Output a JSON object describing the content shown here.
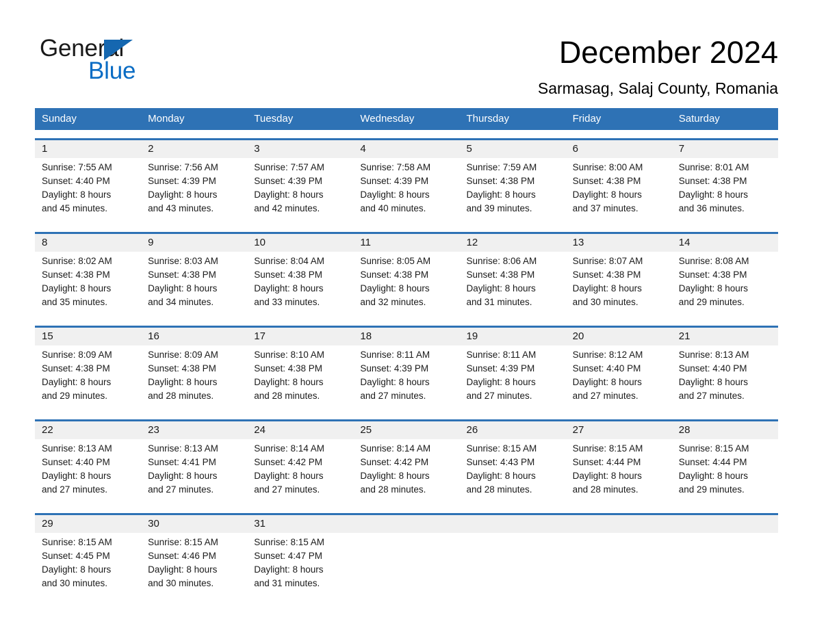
{
  "brand": {
    "name_part1": "General",
    "name_part2": "Blue",
    "accent_color": "#0a6cc4",
    "triangle_color": "#1567b0"
  },
  "header": {
    "month_title": "December 2024",
    "location": "Sarmasag, Salaj County, Romania"
  },
  "calendar": {
    "header_color": "#2e72b5",
    "daynum_strip_color": "#f0f0f0",
    "weekdays": [
      "Sunday",
      "Monday",
      "Tuesday",
      "Wednesday",
      "Thursday",
      "Friday",
      "Saturday"
    ],
    "weeks": [
      [
        {
          "day": "1",
          "sunrise": "Sunrise: 7:55 AM",
          "sunset": "Sunset: 4:40 PM",
          "daylight_line1": "Daylight: 8 hours",
          "daylight_line2": "and 45 minutes."
        },
        {
          "day": "2",
          "sunrise": "Sunrise: 7:56 AM",
          "sunset": "Sunset: 4:39 PM",
          "daylight_line1": "Daylight: 8 hours",
          "daylight_line2": "and 43 minutes."
        },
        {
          "day": "3",
          "sunrise": "Sunrise: 7:57 AM",
          "sunset": "Sunset: 4:39 PM",
          "daylight_line1": "Daylight: 8 hours",
          "daylight_line2": "and 42 minutes."
        },
        {
          "day": "4",
          "sunrise": "Sunrise: 7:58 AM",
          "sunset": "Sunset: 4:39 PM",
          "daylight_line1": "Daylight: 8 hours",
          "daylight_line2": "and 40 minutes."
        },
        {
          "day": "5",
          "sunrise": "Sunrise: 7:59 AM",
          "sunset": "Sunset: 4:38 PM",
          "daylight_line1": "Daylight: 8 hours",
          "daylight_line2": "and 39 minutes."
        },
        {
          "day": "6",
          "sunrise": "Sunrise: 8:00 AM",
          "sunset": "Sunset: 4:38 PM",
          "daylight_line1": "Daylight: 8 hours",
          "daylight_line2": "and 37 minutes."
        },
        {
          "day": "7",
          "sunrise": "Sunrise: 8:01 AM",
          "sunset": "Sunset: 4:38 PM",
          "daylight_line1": "Daylight: 8 hours",
          "daylight_line2": "and 36 minutes."
        }
      ],
      [
        {
          "day": "8",
          "sunrise": "Sunrise: 8:02 AM",
          "sunset": "Sunset: 4:38 PM",
          "daylight_line1": "Daylight: 8 hours",
          "daylight_line2": "and 35 minutes."
        },
        {
          "day": "9",
          "sunrise": "Sunrise: 8:03 AM",
          "sunset": "Sunset: 4:38 PM",
          "daylight_line1": "Daylight: 8 hours",
          "daylight_line2": "and 34 minutes."
        },
        {
          "day": "10",
          "sunrise": "Sunrise: 8:04 AM",
          "sunset": "Sunset: 4:38 PM",
          "daylight_line1": "Daylight: 8 hours",
          "daylight_line2": "and 33 minutes."
        },
        {
          "day": "11",
          "sunrise": "Sunrise: 8:05 AM",
          "sunset": "Sunset: 4:38 PM",
          "daylight_line1": "Daylight: 8 hours",
          "daylight_line2": "and 32 minutes."
        },
        {
          "day": "12",
          "sunrise": "Sunrise: 8:06 AM",
          "sunset": "Sunset: 4:38 PM",
          "daylight_line1": "Daylight: 8 hours",
          "daylight_line2": "and 31 minutes."
        },
        {
          "day": "13",
          "sunrise": "Sunrise: 8:07 AM",
          "sunset": "Sunset: 4:38 PM",
          "daylight_line1": "Daylight: 8 hours",
          "daylight_line2": "and 30 minutes."
        },
        {
          "day": "14",
          "sunrise": "Sunrise: 8:08 AM",
          "sunset": "Sunset: 4:38 PM",
          "daylight_line1": "Daylight: 8 hours",
          "daylight_line2": "and 29 minutes."
        }
      ],
      [
        {
          "day": "15",
          "sunrise": "Sunrise: 8:09 AM",
          "sunset": "Sunset: 4:38 PM",
          "daylight_line1": "Daylight: 8 hours",
          "daylight_line2": "and 29 minutes."
        },
        {
          "day": "16",
          "sunrise": "Sunrise: 8:09 AM",
          "sunset": "Sunset: 4:38 PM",
          "daylight_line1": "Daylight: 8 hours",
          "daylight_line2": "and 28 minutes."
        },
        {
          "day": "17",
          "sunrise": "Sunrise: 8:10 AM",
          "sunset": "Sunset: 4:38 PM",
          "daylight_line1": "Daylight: 8 hours",
          "daylight_line2": "and 28 minutes."
        },
        {
          "day": "18",
          "sunrise": "Sunrise: 8:11 AM",
          "sunset": "Sunset: 4:39 PM",
          "daylight_line1": "Daylight: 8 hours",
          "daylight_line2": "and 27 minutes."
        },
        {
          "day": "19",
          "sunrise": "Sunrise: 8:11 AM",
          "sunset": "Sunset: 4:39 PM",
          "daylight_line1": "Daylight: 8 hours",
          "daylight_line2": "and 27 minutes."
        },
        {
          "day": "20",
          "sunrise": "Sunrise: 8:12 AM",
          "sunset": "Sunset: 4:40 PM",
          "daylight_line1": "Daylight: 8 hours",
          "daylight_line2": "and 27 minutes."
        },
        {
          "day": "21",
          "sunrise": "Sunrise: 8:13 AM",
          "sunset": "Sunset: 4:40 PM",
          "daylight_line1": "Daylight: 8 hours",
          "daylight_line2": "and 27 minutes."
        }
      ],
      [
        {
          "day": "22",
          "sunrise": "Sunrise: 8:13 AM",
          "sunset": "Sunset: 4:40 PM",
          "daylight_line1": "Daylight: 8 hours",
          "daylight_line2": "and 27 minutes."
        },
        {
          "day": "23",
          "sunrise": "Sunrise: 8:13 AM",
          "sunset": "Sunset: 4:41 PM",
          "daylight_line1": "Daylight: 8 hours",
          "daylight_line2": "and 27 minutes."
        },
        {
          "day": "24",
          "sunrise": "Sunrise: 8:14 AM",
          "sunset": "Sunset: 4:42 PM",
          "daylight_line1": "Daylight: 8 hours",
          "daylight_line2": "and 27 minutes."
        },
        {
          "day": "25",
          "sunrise": "Sunrise: 8:14 AM",
          "sunset": "Sunset: 4:42 PM",
          "daylight_line1": "Daylight: 8 hours",
          "daylight_line2": "and 28 minutes."
        },
        {
          "day": "26",
          "sunrise": "Sunrise: 8:15 AM",
          "sunset": "Sunset: 4:43 PM",
          "daylight_line1": "Daylight: 8 hours",
          "daylight_line2": "and 28 minutes."
        },
        {
          "day": "27",
          "sunrise": "Sunrise: 8:15 AM",
          "sunset": "Sunset: 4:44 PM",
          "daylight_line1": "Daylight: 8 hours",
          "daylight_line2": "and 28 minutes."
        },
        {
          "day": "28",
          "sunrise": "Sunrise: 8:15 AM",
          "sunset": "Sunset: 4:44 PM",
          "daylight_line1": "Daylight: 8 hours",
          "daylight_line2": "and 29 minutes."
        }
      ],
      [
        {
          "day": "29",
          "sunrise": "Sunrise: 8:15 AM",
          "sunset": "Sunset: 4:45 PM",
          "daylight_line1": "Daylight: 8 hours",
          "daylight_line2": "and 30 minutes."
        },
        {
          "day": "30",
          "sunrise": "Sunrise: 8:15 AM",
          "sunset": "Sunset: 4:46 PM",
          "daylight_line1": "Daylight: 8 hours",
          "daylight_line2": "and 30 minutes."
        },
        {
          "day": "31",
          "sunrise": "Sunrise: 8:15 AM",
          "sunset": "Sunset: 4:47 PM",
          "daylight_line1": "Daylight: 8 hours",
          "daylight_line2": "and 31 minutes."
        },
        {
          "day": "",
          "sunrise": "",
          "sunset": "",
          "daylight_line1": "",
          "daylight_line2": ""
        },
        {
          "day": "",
          "sunrise": "",
          "sunset": "",
          "daylight_line1": "",
          "daylight_line2": ""
        },
        {
          "day": "",
          "sunrise": "",
          "sunset": "",
          "daylight_line1": "",
          "daylight_line2": ""
        },
        {
          "day": "",
          "sunrise": "",
          "sunset": "",
          "daylight_line1": "",
          "daylight_line2": ""
        }
      ]
    ]
  }
}
